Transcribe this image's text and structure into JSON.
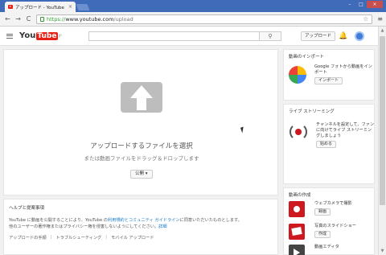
{
  "browser": {
    "tab_title": "アップロード - YouTube",
    "tab_close": "×",
    "url_scheme": "https://",
    "url_host": "www.youtube.com",
    "url_path": "/upload",
    "back_icon": "←",
    "forward_icon": "→",
    "reload_icon": "C",
    "star_icon": "☆",
    "menu_icon": "≡",
    "minimize": "–",
    "maximize": "□",
    "close": "×"
  },
  "header": {
    "logo_you": "You",
    "logo_tube": "Tube",
    "logo_region": "JP",
    "search_icon": "⚲",
    "upload_label": "アップロード",
    "bell_icon": "🔔"
  },
  "upload": {
    "title": "アップロードするファイルを選択",
    "subtitle": "または動画ファイルをドラッグ＆ドロップします",
    "privacy_label": "公開 ▾"
  },
  "help": {
    "title": "ヘルプと提案事項",
    "text_1": "YouTube に動画を公開することにより、YouTube の",
    "link_terms": "利用規約とコミュニティ ガイドライン",
    "text_2": "に同意いただいたものとします。",
    "text_3": "他のユーザーの著作権またはプライバシー権を侵害しないようにしてください。",
    "link_more": "詳細",
    "links": [
      "アップロードの手順",
      "トラブルシューティング",
      "モバイル アップロード"
    ],
    "separator": "|"
  },
  "sidebar": {
    "import": {
      "title": "動画のインポート",
      "desc": "Google フォトから動画をインポート",
      "button": "インポート"
    },
    "live": {
      "title": "ライブ ストリーミング",
      "desc": "チャンネルを設定して、ファンに向けてライブ ストリーミングしましょう",
      "button": "始める"
    },
    "create": {
      "title": "動画の作成",
      "items": [
        {
          "label": "ウェブカメラで撮影",
          "button": "録画"
        },
        {
          "label": "写真のスライドショー",
          "button": "作成"
        },
        {
          "label": "動画エディタ",
          "button": "編集"
        }
      ]
    }
  },
  "scroll": {
    "up": "▲",
    "down": "▼"
  }
}
